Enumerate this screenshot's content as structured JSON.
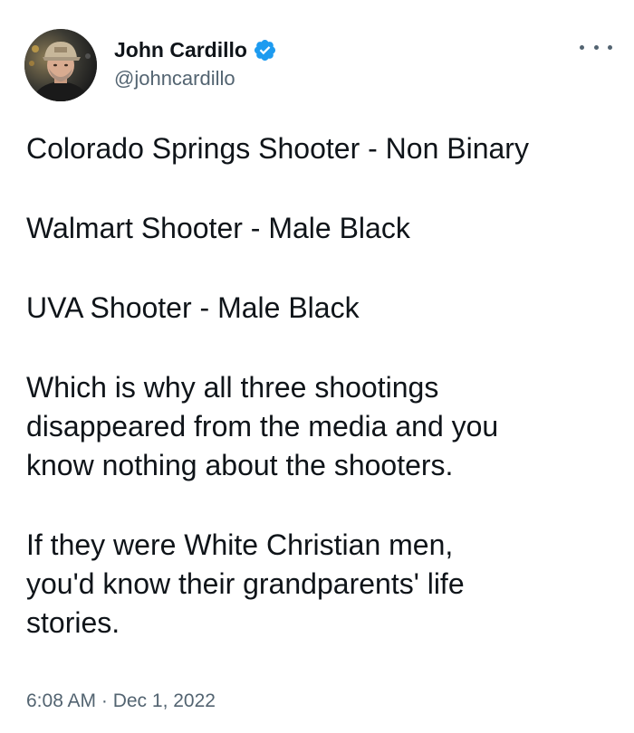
{
  "author": {
    "display_name": "John Cardillo",
    "handle": "@johncardillo",
    "verified": true,
    "verified_icon": "verified-badge-icon",
    "verified_color": "#1d9bf0"
  },
  "tweet": {
    "paragraphs": [
      "Colorado Springs Shooter - Non Binary",
      "Walmart Shooter - Male Black",
      "UVA Shooter - Male Black",
      "Which is why all three shootings\ndisappeared from the media and you\nknow nothing about the shooters.",
      "If they were White Christian men,\nyou'd know their grandparents' life\nstories."
    ],
    "timestamp": "6:08 AM · Dec 1, 2022"
  },
  "menu": {
    "icon": "more-options-icon"
  },
  "colors": {
    "text": "#0f1419",
    "secondary": "#536471",
    "accent": "#1d9bf0"
  }
}
